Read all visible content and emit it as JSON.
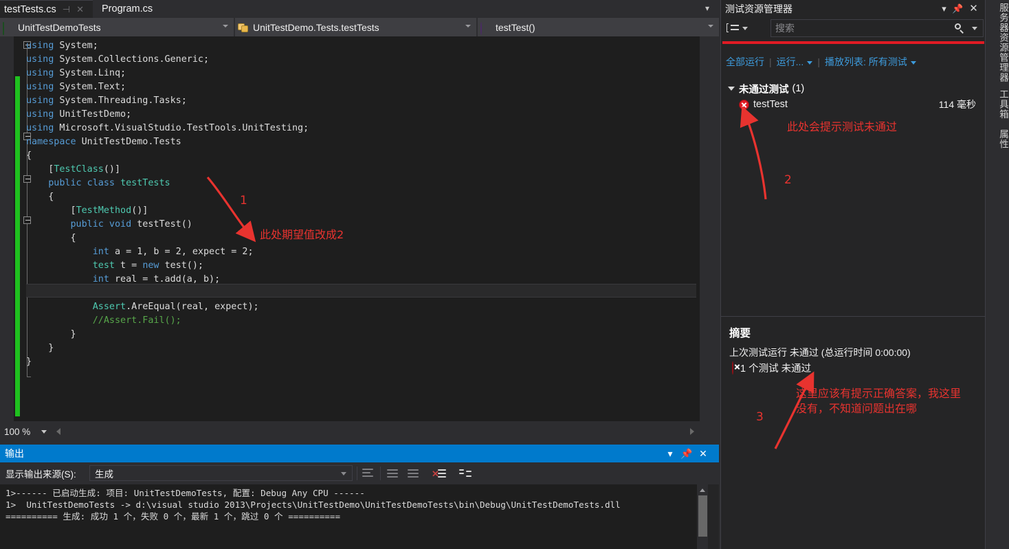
{
  "window": {
    "tabs": [
      {
        "label": "testTests.cs",
        "active": true,
        "pin_icon": "pin-icon",
        "close_icon": "close-icon"
      },
      {
        "label": "Program.cs",
        "active": false
      }
    ],
    "tab_overflow_icon": "chevron-down-icon"
  },
  "navbar": {
    "project": {
      "label": "UnitTestDemoTests",
      "icon": "class-project-icon"
    },
    "type": {
      "label": "UnitTestDemo.Tests.testTests",
      "icon": "puzzle-icon"
    },
    "member": {
      "label": "testTest()",
      "icon": "method-icon"
    }
  },
  "editor": {
    "zoom": "100 %",
    "code_lines": [
      [
        {
          "t": "using ",
          "c": "kw"
        },
        {
          "t": "System;",
          "c": "pl"
        }
      ],
      [
        {
          "t": "using ",
          "c": "kw"
        },
        {
          "t": "System.Collections.Generic;",
          "c": "pl"
        }
      ],
      [
        {
          "t": "using ",
          "c": "kw"
        },
        {
          "t": "System.Linq;",
          "c": "pl"
        }
      ],
      [
        {
          "t": "using ",
          "c": "kw"
        },
        {
          "t": "System.Text;",
          "c": "pl"
        }
      ],
      [
        {
          "t": "using ",
          "c": "kw"
        },
        {
          "t": "System.Threading.Tasks;",
          "c": "pl"
        }
      ],
      [
        {
          "t": "using ",
          "c": "kw"
        },
        {
          "t": "UnitTestDemo;",
          "c": "pl"
        }
      ],
      [
        {
          "t": "using ",
          "c": "kw"
        },
        {
          "t": "Microsoft.VisualStudio.TestTools.UnitTesting;",
          "c": "pl"
        }
      ],
      [
        {
          "t": "namespace ",
          "c": "kw"
        },
        {
          "t": "UnitTestDemo.Tests",
          "c": "pl"
        }
      ],
      [
        {
          "t": "{",
          "c": "pl"
        }
      ],
      [
        {
          "t": "    [",
          "c": "pl"
        },
        {
          "t": "TestClass",
          "c": "attr"
        },
        {
          "t": "()]",
          "c": "pl"
        }
      ],
      [
        {
          "t": "    ",
          "c": "pl"
        },
        {
          "t": "public class ",
          "c": "kw"
        },
        {
          "t": "testTests",
          "c": "cls"
        }
      ],
      [
        {
          "t": "    {",
          "c": "pl"
        }
      ],
      [
        {
          "t": "        [",
          "c": "pl"
        },
        {
          "t": "TestMethod",
          "c": "attr"
        },
        {
          "t": "()]",
          "c": "pl"
        }
      ],
      [
        {
          "t": "        ",
          "c": "pl"
        },
        {
          "t": "public void ",
          "c": "kw"
        },
        {
          "t": "testTest()",
          "c": "pl"
        }
      ],
      [
        {
          "t": "        {",
          "c": "pl"
        }
      ],
      [
        {
          "t": "            ",
          "c": "pl"
        },
        {
          "t": "int ",
          "c": "kw"
        },
        {
          "t": "a = 1, b = 2, expect = 2;",
          "c": "pl"
        }
      ],
      [
        {
          "t": "            ",
          "c": "pl"
        },
        {
          "t": "test",
          "c": "typ"
        },
        {
          "t": " t = ",
          "c": "pl"
        },
        {
          "t": "new ",
          "c": "kw"
        },
        {
          "t": "test();",
          "c": "pl"
        }
      ],
      [
        {
          "t": "            ",
          "c": "pl"
        },
        {
          "t": "int ",
          "c": "kw"
        },
        {
          "t": "real = t.add(a, b);",
          "c": "pl"
        }
      ],
      [
        {
          "t": "",
          "c": "pl"
        }
      ],
      [
        {
          "t": "            ",
          "c": "pl"
        },
        {
          "t": "Assert",
          "c": "typ"
        },
        {
          "t": ".AreEqual(real, expect);",
          "c": "pl"
        }
      ],
      [
        {
          "t": "            ",
          "c": "pl"
        },
        {
          "t": "//Assert.Fail();",
          "c": "cmt"
        }
      ],
      [
        {
          "t": "        }",
          "c": "pl"
        }
      ],
      [
        {
          "t": "    }",
          "c": "pl"
        }
      ],
      [
        {
          "t": "}",
          "c": "pl"
        }
      ]
    ]
  },
  "output": {
    "title": "输出",
    "dropdown_icon": "chevron-down-icon",
    "pin_icon": "pin-icon",
    "close_icon": "close-icon",
    "source_label": "显示输出来源(S):",
    "source_value": "生成",
    "lines": [
      "1>------ 已启动生成: 项目: UnitTestDemoTests, 配置: Debug Any CPU ------",
      "1>  UnitTestDemoTests -> d:\\visual studio 2013\\Projects\\UnitTestDemo\\UnitTestDemoTests\\bin\\Debug\\UnitTestDemoTests.dll",
      "========== 生成: 成功 1 个，失败 0 个，最新 1 个，跳过 0 个 =========="
    ]
  },
  "test_explorer": {
    "title": "测试资源管理器",
    "dropdown_icon": "chevron-down-icon",
    "pin_icon": "pin-icon",
    "close_icon": "close-icon",
    "group_button_icon": "group-by-icon",
    "search_placeholder": "搜索",
    "search_value": "",
    "search_icon": "search-icon",
    "actions": {
      "run_all": "全部运行",
      "run": "运行...",
      "playlist": "播放列表: 所有测试"
    },
    "group": {
      "name": "未通过测试",
      "count": "(1)",
      "expander_icon": "triangle-down-icon"
    },
    "test": {
      "name": "testTest",
      "duration": "114 毫秒",
      "status_icon": "fail-icon"
    },
    "summary": {
      "title": "摘要",
      "last_run": "上次测试运行 未通过 (总运行时间 0:00:00)",
      "result_text": "1 个测试 未通过",
      "result_icon": "fail-icon"
    }
  },
  "annotations": [
    {
      "id": "1",
      "number": "1",
      "text": "此处期望值改成2"
    },
    {
      "id": "2",
      "number": "2",
      "text": "此处会提示测试未通过"
    },
    {
      "id": "3",
      "number": "3",
      "text": "这里应该有提示正确答案，我这里\n没有，不知道问题出在哪"
    }
  ],
  "vertical_tabs": [
    "服务器资源管理器",
    "工具箱",
    "属性"
  ],
  "colors": {
    "accent_blue": "#007acc",
    "error_red": "#e01b24",
    "change_green": "#1fc11f",
    "annotation_red": "#e8332f",
    "editor_bg": "#1e1e1e",
    "chrome_bg": "#2d2d30"
  }
}
